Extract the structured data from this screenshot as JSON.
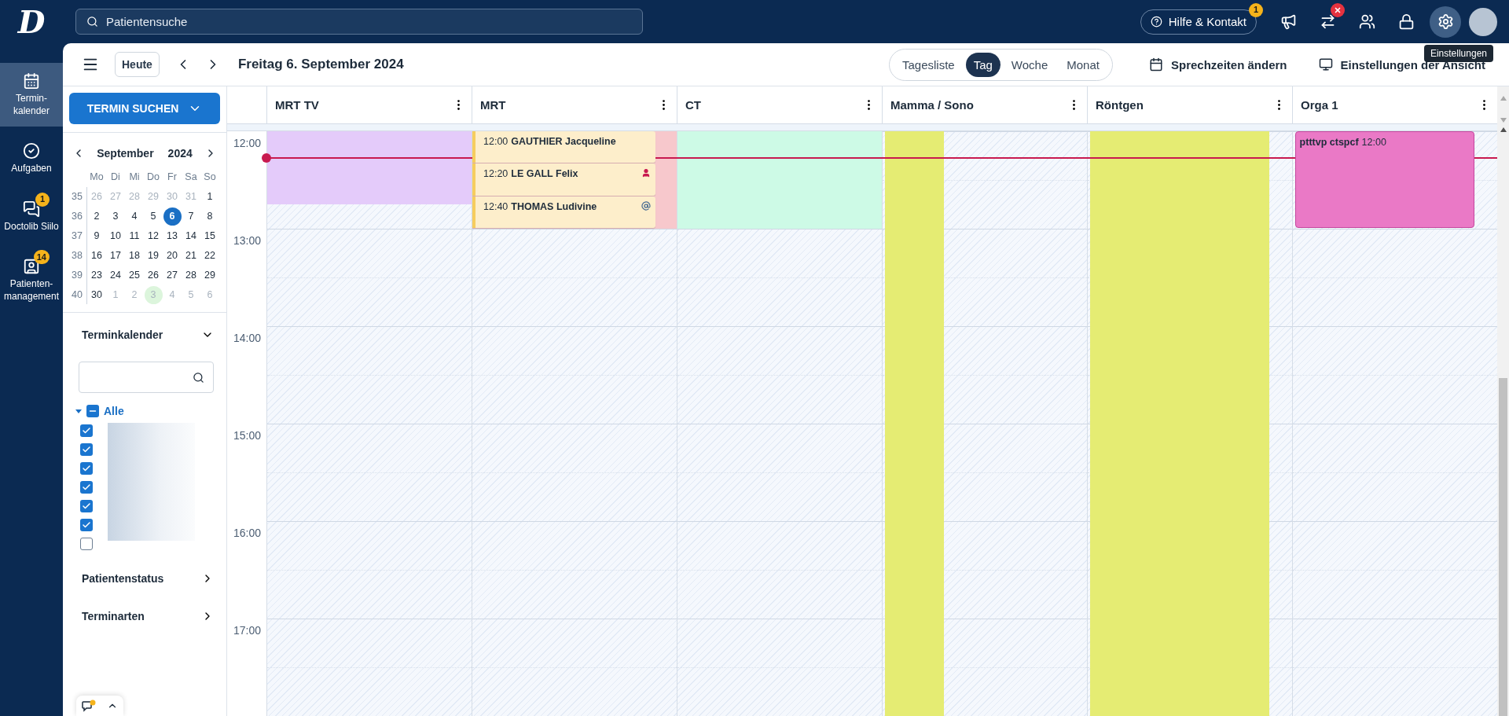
{
  "logo": "D",
  "search": {
    "placeholder": "Patientensuche"
  },
  "help": {
    "label": "Hilfe & Kontakt",
    "badge": "1"
  },
  "top_icons": [
    {
      "kind": "megaphone",
      "alert": false,
      "selected": false
    },
    {
      "kind": "transfer",
      "alert": true,
      "selected": false
    },
    {
      "kind": "team",
      "alert": false,
      "selected": false
    },
    {
      "kind": "lock",
      "alert": false,
      "selected": false
    },
    {
      "kind": "settings",
      "alert": false,
      "selected": true
    }
  ],
  "tooltip": "Einstellungen",
  "nav": [
    {
      "label": "Termin-\nkalender",
      "selected": true
    },
    {
      "label": "Aufgaben",
      "selected": false
    },
    {
      "label": "Doctolib Siilo",
      "selected": false,
      "badge": "1"
    },
    {
      "label": "Patienten-\nmanagement",
      "selected": false,
      "badge": "14"
    }
  ],
  "toolbar": {
    "today": "Heute",
    "date": "Freitag 6. September 2024",
    "views": [
      {
        "label": "Tagesliste",
        "selected": false
      },
      {
        "label": "Tag",
        "selected": true
      },
      {
        "label": "Woche",
        "selected": false
      },
      {
        "label": "Monat",
        "selected": false
      }
    ],
    "actions": [
      "Sprechzeiten ändern",
      "Einstellungen der Ansicht"
    ]
  },
  "search_button": "TERMIN SUCHEN",
  "mini_calendar": {
    "month": "September",
    "year": "2024",
    "weekdays": [
      "Mo",
      "Di",
      "Mi",
      "Do",
      "Fr",
      "Sa",
      "So"
    ],
    "weeks": [
      {
        "number": "35",
        "days": [
          {
            "d": "26",
            "muted": true,
            "selected": false,
            "marked": false
          },
          {
            "d": "27",
            "muted": true,
            "selected": false,
            "marked": false
          },
          {
            "d": "28",
            "muted": true,
            "selected": false,
            "marked": false
          },
          {
            "d": "29",
            "muted": true,
            "selected": false,
            "marked": false
          },
          {
            "d": "30",
            "muted": true,
            "selected": false,
            "marked": false
          },
          {
            "d": "31",
            "muted": true,
            "selected": false,
            "marked": false
          },
          {
            "d": "1",
            "muted": false,
            "selected": false,
            "marked": false
          }
        ]
      },
      {
        "number": "36",
        "days": [
          {
            "d": "2",
            "muted": false,
            "selected": false,
            "marked": false
          },
          {
            "d": "3",
            "muted": false,
            "selected": false,
            "marked": false
          },
          {
            "d": "4",
            "muted": false,
            "selected": false,
            "marked": false
          },
          {
            "d": "5",
            "muted": false,
            "selected": false,
            "marked": false
          },
          {
            "d": "6",
            "muted": false,
            "selected": true,
            "marked": false
          },
          {
            "d": "7",
            "muted": false,
            "selected": false,
            "marked": false
          },
          {
            "d": "8",
            "muted": false,
            "selected": false,
            "marked": false
          }
        ]
      },
      {
        "number": "37",
        "days": [
          {
            "d": "9",
            "muted": false,
            "selected": false,
            "marked": false
          },
          {
            "d": "10",
            "muted": false,
            "selected": false,
            "marked": false
          },
          {
            "d": "11",
            "muted": false,
            "selected": false,
            "marked": false
          },
          {
            "d": "12",
            "muted": false,
            "selected": false,
            "marked": false
          },
          {
            "d": "13",
            "muted": false,
            "selected": false,
            "marked": false
          },
          {
            "d": "14",
            "muted": false,
            "selected": false,
            "marked": false
          },
          {
            "d": "15",
            "muted": false,
            "selected": false,
            "marked": false
          }
        ]
      },
      {
        "number": "38",
        "days": [
          {
            "d": "16",
            "muted": false,
            "selected": false,
            "marked": false
          },
          {
            "d": "17",
            "muted": false,
            "selected": false,
            "marked": false
          },
          {
            "d": "18",
            "muted": false,
            "selected": false,
            "marked": false
          },
          {
            "d": "19",
            "muted": false,
            "selected": false,
            "marked": false
          },
          {
            "d": "20",
            "muted": false,
            "selected": false,
            "marked": false
          },
          {
            "d": "21",
            "muted": false,
            "selected": false,
            "marked": false
          },
          {
            "d": "22",
            "muted": false,
            "selected": false,
            "marked": false
          }
        ]
      },
      {
        "number": "39",
        "days": [
          {
            "d": "23",
            "muted": false,
            "selected": false,
            "marked": false
          },
          {
            "d": "24",
            "muted": false,
            "selected": false,
            "marked": false
          },
          {
            "d": "25",
            "muted": false,
            "selected": false,
            "marked": false
          },
          {
            "d": "26",
            "muted": false,
            "selected": false,
            "marked": false
          },
          {
            "d": "27",
            "muted": false,
            "selected": false,
            "marked": false
          },
          {
            "d": "28",
            "muted": false,
            "selected": false,
            "marked": false
          },
          {
            "d": "29",
            "muted": false,
            "selected": false,
            "marked": false
          }
        ]
      },
      {
        "number": "40",
        "days": [
          {
            "d": "30",
            "muted": false,
            "selected": false,
            "marked": false
          },
          {
            "d": "1",
            "muted": true,
            "selected": false,
            "marked": false
          },
          {
            "d": "2",
            "muted": true,
            "selected": false,
            "marked": false
          },
          {
            "d": "3",
            "muted": true,
            "selected": false,
            "marked": true
          },
          {
            "d": "4",
            "muted": true,
            "selected": false,
            "marked": false
          },
          {
            "d": "5",
            "muted": true,
            "selected": false,
            "marked": false
          },
          {
            "d": "6",
            "muted": true,
            "selected": false,
            "marked": false
          }
        ]
      }
    ]
  },
  "calendar_filter": {
    "title": "Terminkalender",
    "expanded": true,
    "tree": {
      "label": "Alle",
      "expanded": true,
      "indeterminate": true,
      "children": [
        {
          "checked": true
        },
        {
          "checked": true
        },
        {
          "checked": true
        },
        {
          "checked": true
        },
        {
          "checked": true
        },
        {
          "checked": true
        },
        {
          "checked": false
        }
      ]
    }
  },
  "sections": [
    {
      "title": "Patientenstatus",
      "expanded": false
    },
    {
      "title": "Terminarten",
      "expanded": false
    }
  ],
  "hours": [
    "12:00",
    "13:00",
    "14:00",
    "15:00",
    "16:00",
    "17:00"
  ],
  "now_line": {
    "level": 0.046
  },
  "columns": [
    {
      "title": "MRT TV",
      "blocks": [
        {
          "kind": "short",
          "color": "#e4cbfa"
        }
      ]
    },
    {
      "title": "MRT",
      "blocks": [
        {
          "kind": "hour",
          "color": "#f7c8cc"
        }
      ],
      "events": [
        {
          "kind": "appointment",
          "time": "12:00",
          "name": "GAUTHIER Jacqueline",
          "arrived": false,
          "online": false
        },
        {
          "kind": "appointment",
          "time": "12:20",
          "name": "LE GALL Felix",
          "arrived": true,
          "online": false
        },
        {
          "kind": "appointment",
          "time": "12:40",
          "name": "THOMAS Ludivine",
          "arrived": false,
          "online": true
        }
      ]
    },
    {
      "title": "CT",
      "blocks": [
        {
          "kind": "hour",
          "color": "#cdfae6"
        }
      ]
    },
    {
      "title": "Mamma / Sono",
      "blocks": [
        {
          "kind": "narrow",
          "color": "#e5ec73"
        }
      ]
    },
    {
      "title": "Röntgen",
      "blocks": [
        {
          "kind": "lane",
          "color": "#e5ec73"
        }
      ]
    },
    {
      "title": "Orga 1",
      "events": [
        {
          "kind": "block",
          "time": "12:00",
          "name": "ptttvp ctspcf",
          "arrived": false,
          "online": false
        }
      ]
    }
  ]
}
